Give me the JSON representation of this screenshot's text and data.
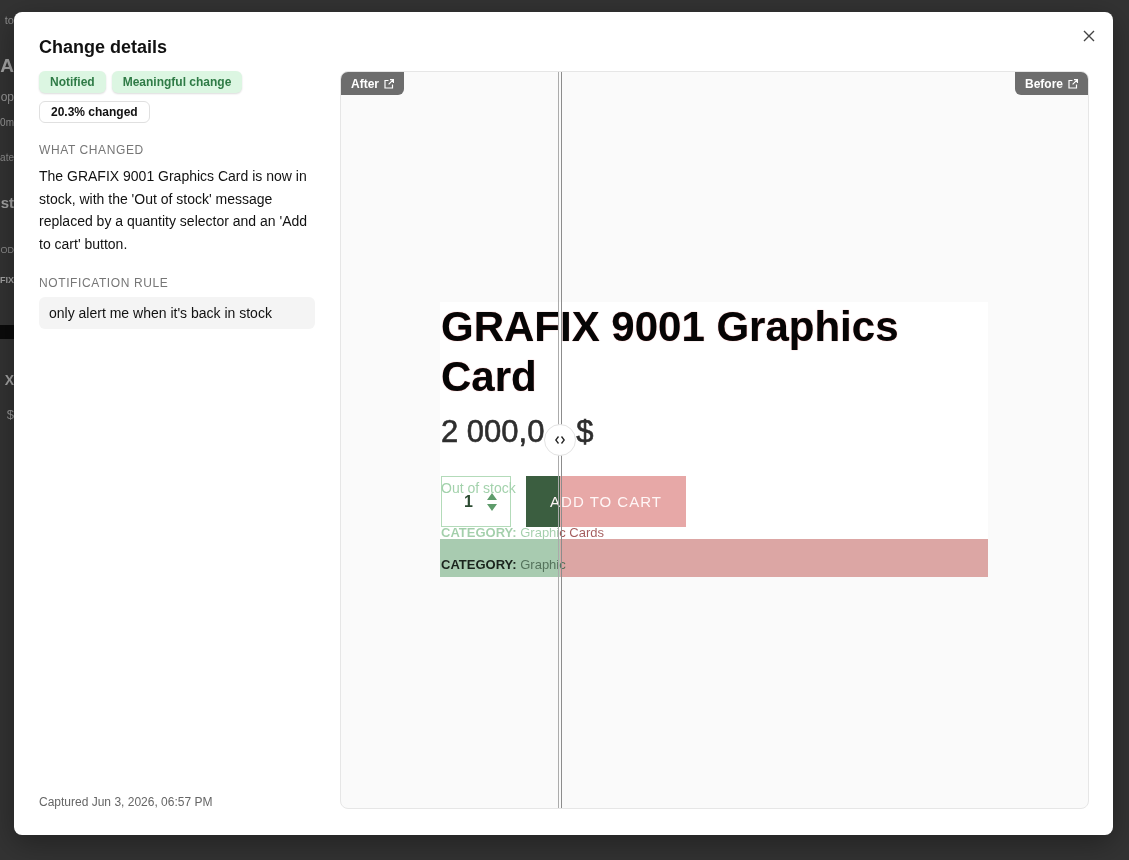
{
  "backdrop": {
    "fragments": [
      {
        "text": "to",
        "kind": "caption"
      },
      {
        "text": "A",
        "kind": "title"
      },
      {
        "text": "op",
        "kind": "text"
      },
      {
        "text": "0m",
        "kind": "text"
      },
      {
        "text": "ate",
        "kind": "caption"
      },
      {
        "text": "st",
        "kind": "title"
      },
      {
        "text": "OD",
        "kind": "caption"
      },
      {
        "text": "FIX",
        "kind": "title"
      },
      {
        "kind": "bar"
      },
      {
        "text": "X",
        "kind": "title"
      },
      {
        "text": "$",
        "kind": "text"
      }
    ]
  },
  "dialog": {
    "title": "Change details",
    "badges": [
      {
        "label": "Notified",
        "kind": "positive"
      },
      {
        "label": "Meaningful change",
        "kind": "positive"
      },
      {
        "label": "20.3% changed",
        "kind": "neutral"
      }
    ],
    "sections": [
      {
        "heading": "WHAT CHANGED",
        "kind": "text",
        "text": "The GRAFIX 9001 Graphics Card is now in stock, with the 'Out of stock' message replaced by a quantity selector and an 'Add to cart' button."
      },
      {
        "heading": "NOTIFICATION RULE",
        "kind": "rule",
        "text": "only alert me when it's back in stock"
      }
    ],
    "captured": "Captured Jun 3, 2026, 06:57 PM",
    "comparison": {
      "after_label": "After",
      "before_label": "Before",
      "divider": {
        "level": 0.294
      },
      "page": {
        "heading": "GRAFIX 9001 Graphics Card",
        "price_left": "2 000,0",
        "price_right": "$",
        "stock_message": "Out of stock",
        "quantity": "1",
        "add_button": "ADD TO CART",
        "category_line": "**CATEGORY:** Graphic Cards",
        "category_band": "**CATEGORY:** Graphic"
      }
    }
  }
}
